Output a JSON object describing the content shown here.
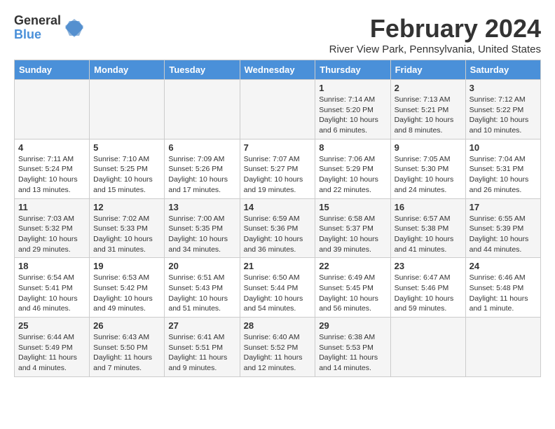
{
  "logo": {
    "general": "General",
    "blue": "Blue"
  },
  "title": "February 2024",
  "subtitle": "River View Park, Pennsylvania, United States",
  "calendar": {
    "headers": [
      "Sunday",
      "Monday",
      "Tuesday",
      "Wednesday",
      "Thursday",
      "Friday",
      "Saturday"
    ],
    "weeks": [
      [
        {
          "day": "",
          "info": ""
        },
        {
          "day": "",
          "info": ""
        },
        {
          "day": "",
          "info": ""
        },
        {
          "day": "",
          "info": ""
        },
        {
          "day": "1",
          "info": "Sunrise: 7:14 AM\nSunset: 5:20 PM\nDaylight: 10 hours\nand 6 minutes."
        },
        {
          "day": "2",
          "info": "Sunrise: 7:13 AM\nSunset: 5:21 PM\nDaylight: 10 hours\nand 8 minutes."
        },
        {
          "day": "3",
          "info": "Sunrise: 7:12 AM\nSunset: 5:22 PM\nDaylight: 10 hours\nand 10 minutes."
        }
      ],
      [
        {
          "day": "4",
          "info": "Sunrise: 7:11 AM\nSunset: 5:24 PM\nDaylight: 10 hours\nand 13 minutes."
        },
        {
          "day": "5",
          "info": "Sunrise: 7:10 AM\nSunset: 5:25 PM\nDaylight: 10 hours\nand 15 minutes."
        },
        {
          "day": "6",
          "info": "Sunrise: 7:09 AM\nSunset: 5:26 PM\nDaylight: 10 hours\nand 17 minutes."
        },
        {
          "day": "7",
          "info": "Sunrise: 7:07 AM\nSunset: 5:27 PM\nDaylight: 10 hours\nand 19 minutes."
        },
        {
          "day": "8",
          "info": "Sunrise: 7:06 AM\nSunset: 5:29 PM\nDaylight: 10 hours\nand 22 minutes."
        },
        {
          "day": "9",
          "info": "Sunrise: 7:05 AM\nSunset: 5:30 PM\nDaylight: 10 hours\nand 24 minutes."
        },
        {
          "day": "10",
          "info": "Sunrise: 7:04 AM\nSunset: 5:31 PM\nDaylight: 10 hours\nand 26 minutes."
        }
      ],
      [
        {
          "day": "11",
          "info": "Sunrise: 7:03 AM\nSunset: 5:32 PM\nDaylight: 10 hours\nand 29 minutes."
        },
        {
          "day": "12",
          "info": "Sunrise: 7:02 AM\nSunset: 5:33 PM\nDaylight: 10 hours\nand 31 minutes."
        },
        {
          "day": "13",
          "info": "Sunrise: 7:00 AM\nSunset: 5:35 PM\nDaylight: 10 hours\nand 34 minutes."
        },
        {
          "day": "14",
          "info": "Sunrise: 6:59 AM\nSunset: 5:36 PM\nDaylight: 10 hours\nand 36 minutes."
        },
        {
          "day": "15",
          "info": "Sunrise: 6:58 AM\nSunset: 5:37 PM\nDaylight: 10 hours\nand 39 minutes."
        },
        {
          "day": "16",
          "info": "Sunrise: 6:57 AM\nSunset: 5:38 PM\nDaylight: 10 hours\nand 41 minutes."
        },
        {
          "day": "17",
          "info": "Sunrise: 6:55 AM\nSunset: 5:39 PM\nDaylight: 10 hours\nand 44 minutes."
        }
      ],
      [
        {
          "day": "18",
          "info": "Sunrise: 6:54 AM\nSunset: 5:41 PM\nDaylight: 10 hours\nand 46 minutes."
        },
        {
          "day": "19",
          "info": "Sunrise: 6:53 AM\nSunset: 5:42 PM\nDaylight: 10 hours\nand 49 minutes."
        },
        {
          "day": "20",
          "info": "Sunrise: 6:51 AM\nSunset: 5:43 PM\nDaylight: 10 hours\nand 51 minutes."
        },
        {
          "day": "21",
          "info": "Sunrise: 6:50 AM\nSunset: 5:44 PM\nDaylight: 10 hours\nand 54 minutes."
        },
        {
          "day": "22",
          "info": "Sunrise: 6:49 AM\nSunset: 5:45 PM\nDaylight: 10 hours\nand 56 minutes."
        },
        {
          "day": "23",
          "info": "Sunrise: 6:47 AM\nSunset: 5:46 PM\nDaylight: 10 hours\nand 59 minutes."
        },
        {
          "day": "24",
          "info": "Sunrise: 6:46 AM\nSunset: 5:48 PM\nDaylight: 11 hours\nand 1 minute."
        }
      ],
      [
        {
          "day": "25",
          "info": "Sunrise: 6:44 AM\nSunset: 5:49 PM\nDaylight: 11 hours\nand 4 minutes."
        },
        {
          "day": "26",
          "info": "Sunrise: 6:43 AM\nSunset: 5:50 PM\nDaylight: 11 hours\nand 7 minutes."
        },
        {
          "day": "27",
          "info": "Sunrise: 6:41 AM\nSunset: 5:51 PM\nDaylight: 11 hours\nand 9 minutes."
        },
        {
          "day": "28",
          "info": "Sunrise: 6:40 AM\nSunset: 5:52 PM\nDaylight: 11 hours\nand 12 minutes."
        },
        {
          "day": "29",
          "info": "Sunrise: 6:38 AM\nSunset: 5:53 PM\nDaylight: 11 hours\nand 14 minutes."
        },
        {
          "day": "",
          "info": ""
        },
        {
          "day": "",
          "info": ""
        }
      ]
    ]
  }
}
